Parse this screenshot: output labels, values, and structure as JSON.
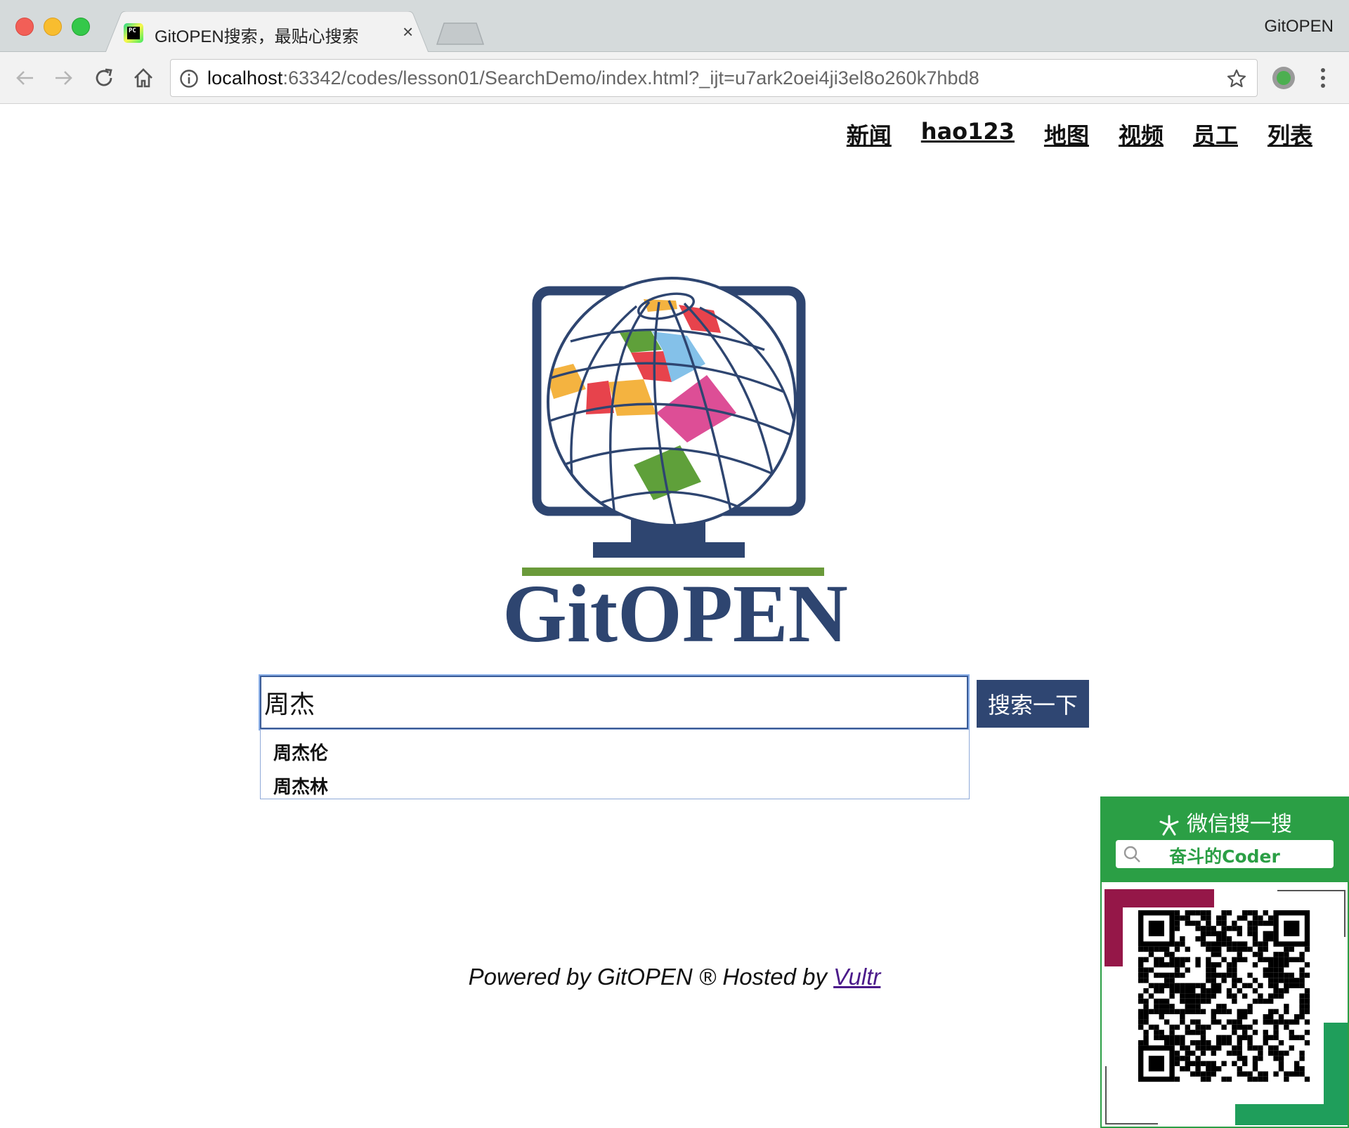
{
  "window": {
    "title": "GitOPEN"
  },
  "tab": {
    "title": "GitOPEN搜索，最贴心搜索",
    "close": "×"
  },
  "address": {
    "host": "localhost",
    "rest": ":63342/codes/lesson01/SearchDemo/index.html?_ijt=u7ark2oei4ji3el8o260k7hbd8"
  },
  "topnav": [
    "新闻",
    "hao123",
    "地图",
    "视频",
    "员工",
    "列表"
  ],
  "search": {
    "value": "周杰",
    "button": "搜索一下",
    "suggestions": [
      "周杰伦",
      "周杰林"
    ]
  },
  "footer": {
    "prefix": "Powered by GitOPEN ® Hosted by ",
    "link": "Vultr"
  },
  "wechat": {
    "title": "微信搜一搜",
    "account": "奋斗的Coder"
  },
  "logo": {
    "wordmark": "GitOPEN"
  },
  "colors": {
    "brand_navy": "#2f4672",
    "wechat_green": "#2b9f45"
  }
}
